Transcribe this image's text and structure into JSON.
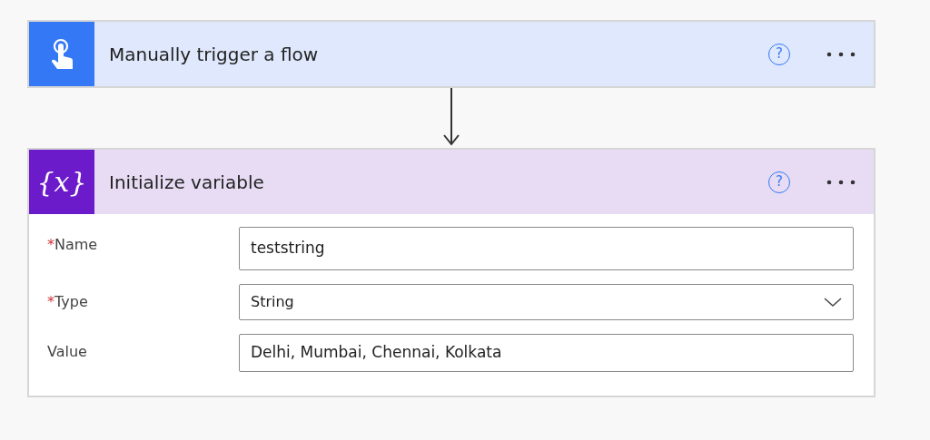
{
  "steps": [
    {
      "title": "Manually trigger a flow",
      "kind": "trigger",
      "help": "?"
    },
    {
      "title": "Initialize variable",
      "kind": "variable",
      "icon_text": "{x}",
      "help": "?",
      "fields": [
        {
          "label": "Name",
          "required_mark": "*",
          "kind": "text",
          "value": "teststring"
        },
        {
          "label": "Type",
          "required_mark": "*",
          "kind": "select",
          "value": "String"
        },
        {
          "label": "Value",
          "kind": "text",
          "value": "Delhi, Mumbai, Chennai, Kolkata"
        }
      ]
    }
  ]
}
